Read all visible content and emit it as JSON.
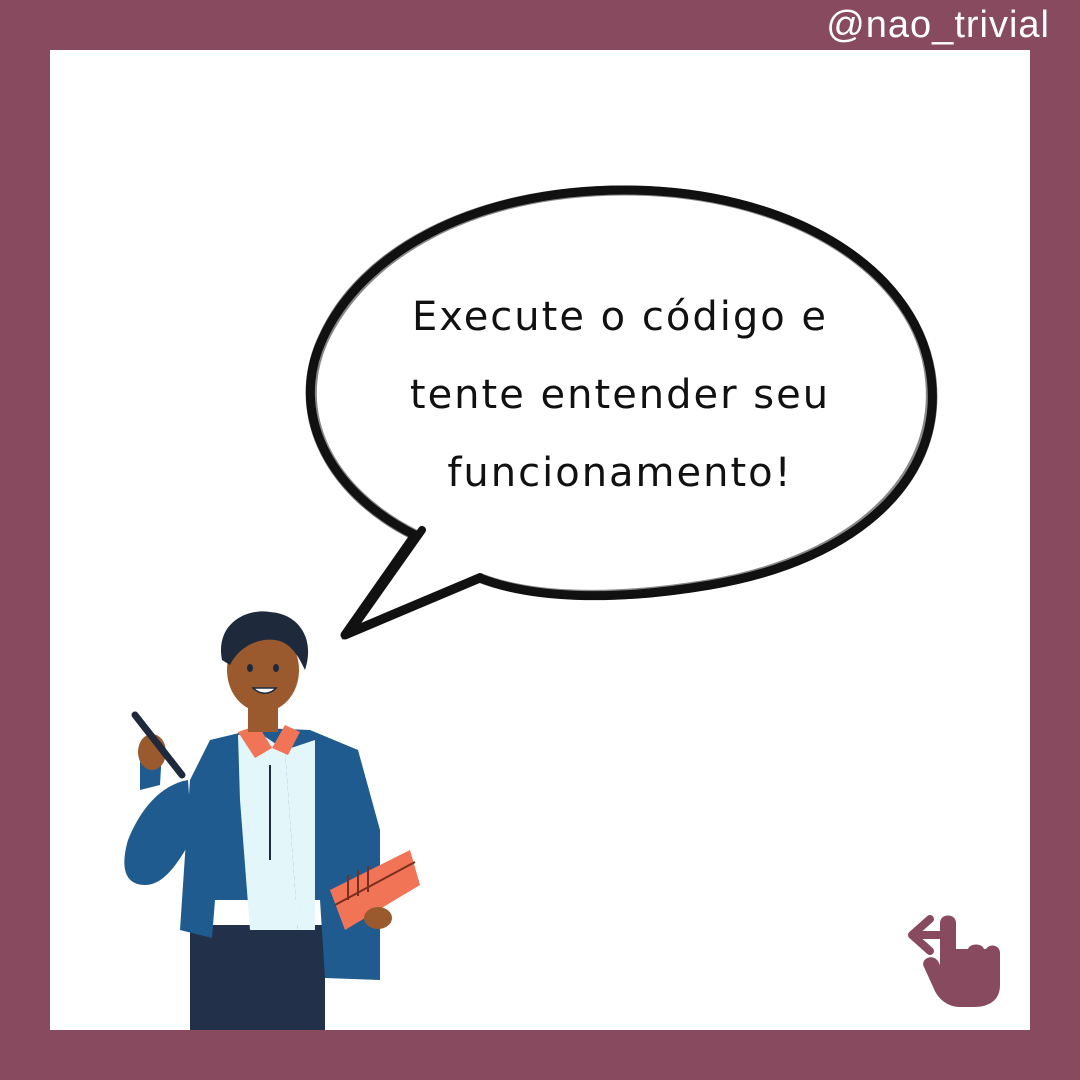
{
  "handle": "@nao_trivial",
  "bubble": {
    "lines": [
      "Execute o código e",
      "tente entender seu",
      "funcionamento!"
    ]
  },
  "icons": {
    "swipe": "swipe-left-hand-icon",
    "person": "teacher-illustration"
  },
  "colors": {
    "frame": "#874A5F",
    "card": "#FFFFFF",
    "bubble_outline": "#111111",
    "jacket": "#1F5B8F",
    "shirt": "#E3F7FA",
    "collar": "#F07455",
    "book": "#F07455",
    "pants": "#22304A",
    "skin": "#9A5A2E",
    "hair": "#1E2A3C"
  }
}
